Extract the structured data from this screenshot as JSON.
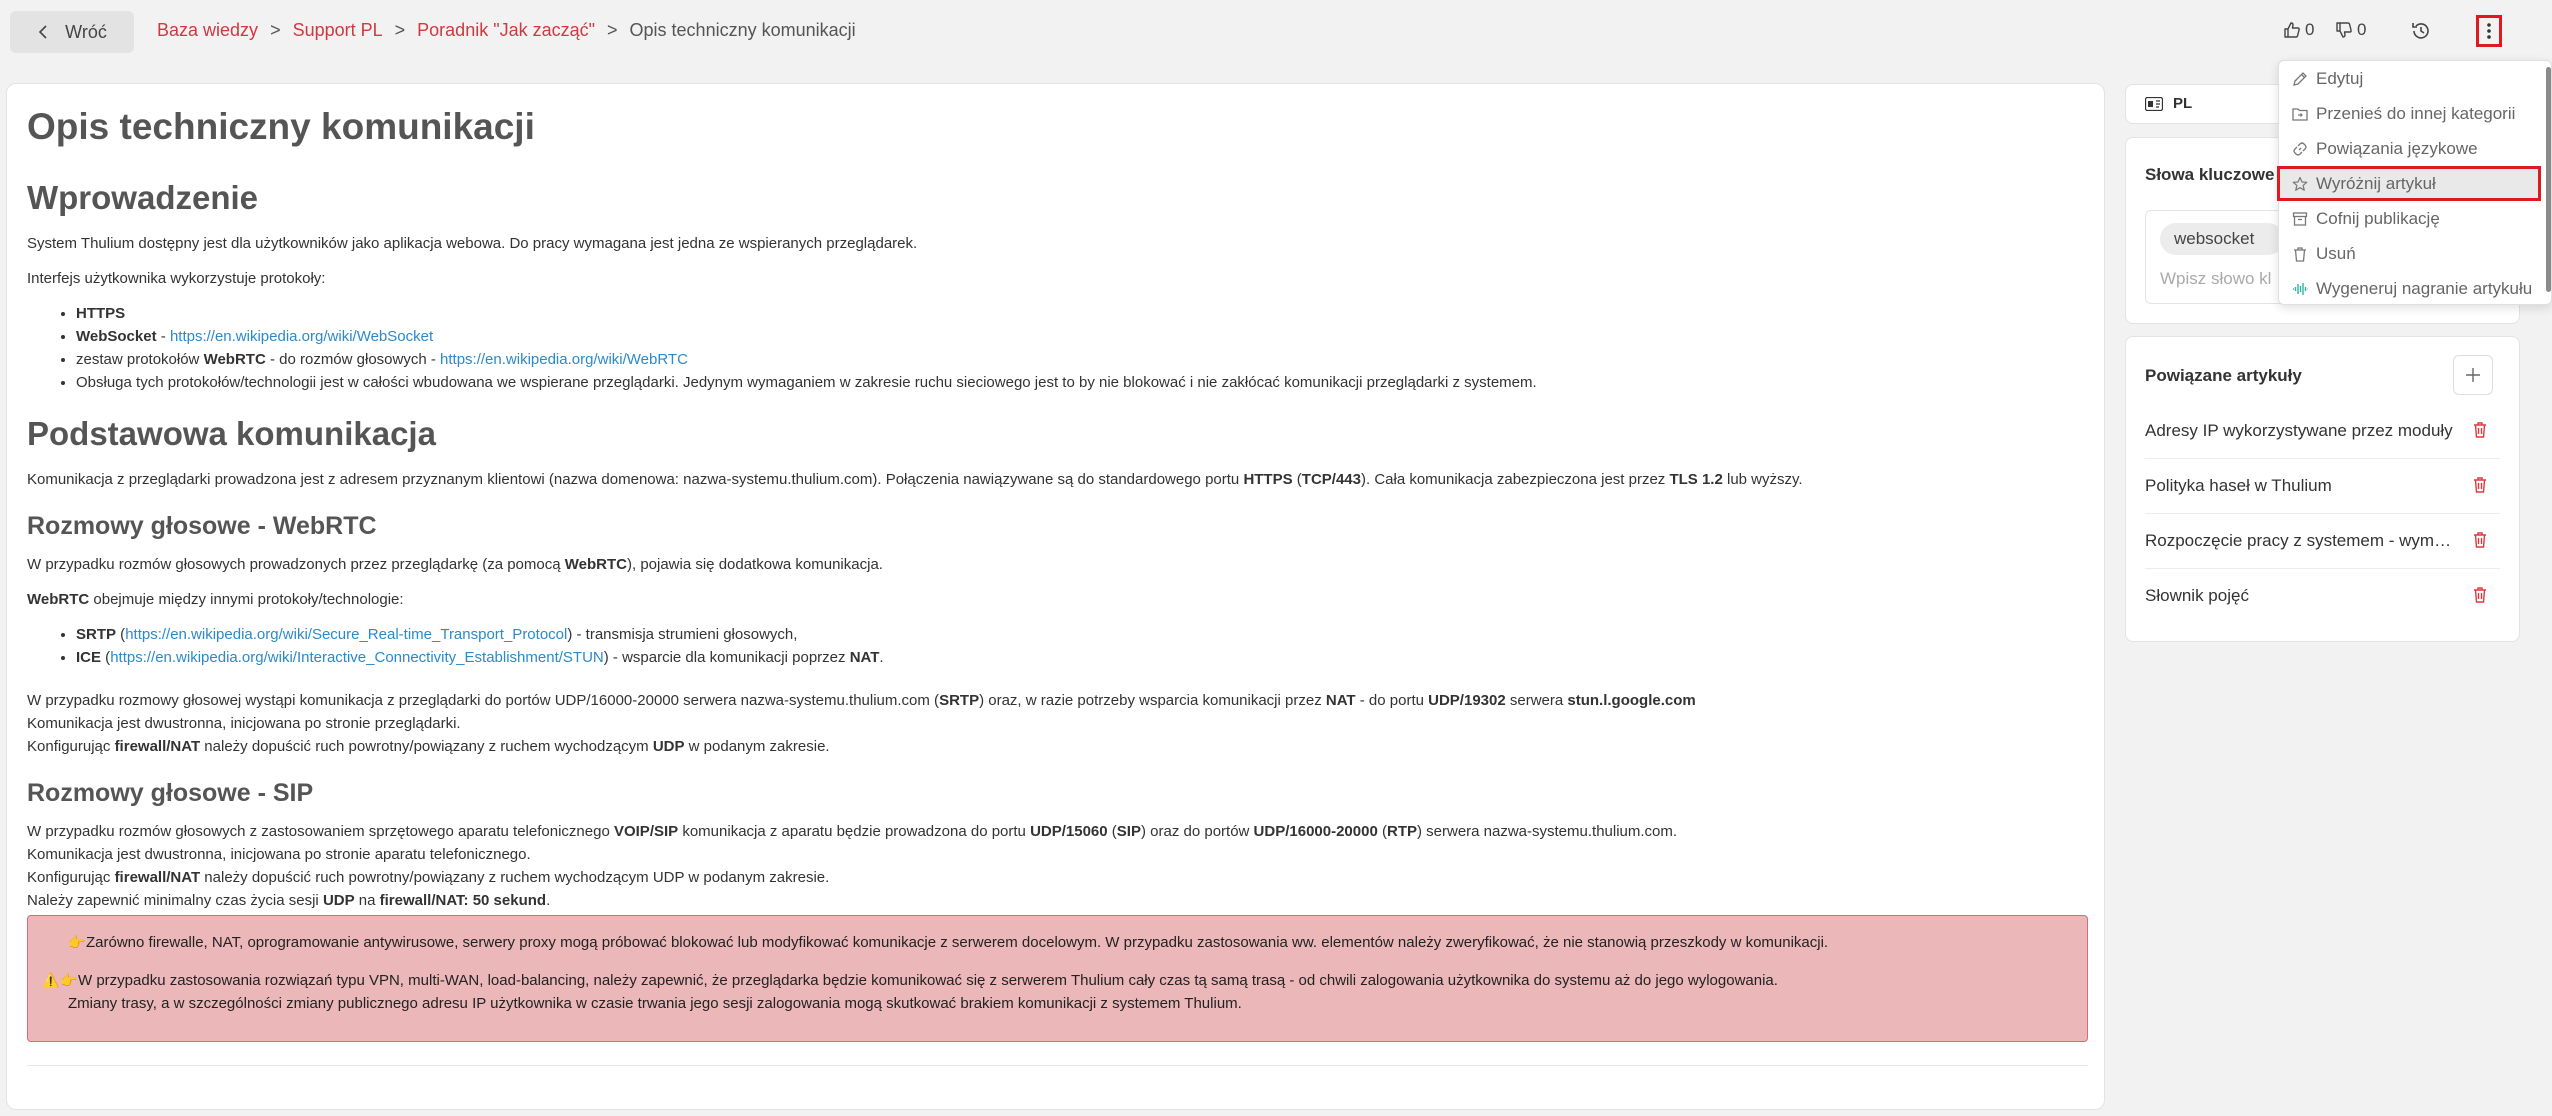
{
  "topbar": {
    "back_label": "Wróć",
    "breadcrumb": {
      "items": [
        "Baza wiedzy",
        "Support PL",
        "Poradnik \"Jak zacząć\""
      ],
      "separator": ">",
      "current": "Opis techniczny komunikacji"
    },
    "likes": "0",
    "dislikes": "0"
  },
  "article": {
    "title": "Opis techniczny komunikacji",
    "intro": {
      "heading": "Wprowadzenie",
      "p1": "System Thulium dostępny jest dla użytkowników jako aplikacja webowa. Do pracy wymagana jest jedna ze wspieranych przeglądarek.",
      "p2": "Interfejs użytkownika wykorzystuje protokoły:",
      "li1": "HTTPS",
      "li2_bold": "WebSocket",
      "li2_sep": " - ",
      "li2_link": "https://en.wikipedia.org/wiki/WebSocket",
      "li3_pre": "zestaw protokołów ",
      "li3_bold": "WebRTC",
      "li3_mid": " - do rozmów głosowych - ",
      "li3_link": "https://en.wikipedia.org/wiki/WebRTC",
      "li4": "Obsługa tych protokołów/technologii jest w całości wbudowana we wspierane przeglądarki. Jedynym wymaganiem w zakresie ruchu sieciowego jest to by nie blokować i nie zakłócać komunikacji przeglądarki z systemem."
    },
    "basic": {
      "heading": "Podstawowa komunikacja",
      "p_a": "Komunikacja z przeglądarki prowadzona jest z adresem przyznanym klientowi (nazwa domenowa: nazwa-systemu.thulium.com). Połączenia nawiązywane są do standardowego portu ",
      "p_b": "HTTPS",
      "p_c": " (",
      "p_d": "TCP/443",
      "p_e": "). Cała komunikacja zabezpieczona jest przez ",
      "p_f": "TLS 1.2",
      "p_g": " lub wyższy."
    },
    "webrtc": {
      "heading": "Rozmowy głosowe - WebRTC",
      "p1_a": "W przypadku rozmów głosowych prowadzonych przez przeglądarkę (za pomocą ",
      "p1_b": "WebRTC",
      "p1_c": "), pojawia się dodatkowa komunikacja.",
      "p2_a": "WebRTC",
      "p2_b": " obejmuje między innymi protokoły/technologie:",
      "li1_bold": "SRTP",
      "li1_open": " (",
      "li1_link": "https://en.wikipedia.org/wiki/Secure_Real-time_Transport_Protocol",
      "li1_rest": ") - transmisja strumieni głosowych,",
      "li2_bold": "ICE",
      "li2_open": " (",
      "li2_link": "https://en.wikipedia.org/wiki/Interactive_Connectivity_Establishment/STUN",
      "li2_rest": ") - wsparcie dla komunikacji poprzez ",
      "li2_nat": "NAT",
      "li2_dot": ".",
      "p3_a": "W przypadku rozmowy głosowej wystąpi komunikacja z przeglądarki do portów UDP/16000-20000 serwera nazwa-systemu.thulium.com (",
      "p3_b": "SRTP",
      "p3_c": ") oraz, w razie potrzeby wsparcia komunikacji przez ",
      "p3_d": "NAT",
      "p3_e": " - do portu ",
      "p3_f": "UDP/19302",
      "p3_g": " serwera ",
      "p3_h": "stun.l.google.com",
      "p4": "Komunikacja jest dwustronna, inicjowana po stronie przeglądarki.",
      "p5_a": "Konfigurując ",
      "p5_b": "firewall/NAT",
      "p5_c": " należy dopuścić ruch powrotny/powiązany z ruchem wychodzącym ",
      "p5_d": "UDP",
      "p5_e": " w podanym zakresie."
    },
    "sip": {
      "heading": "Rozmowy głosowe - SIP",
      "p1_a": "W przypadku rozmów głosowych z zastosowaniem sprzętowego aparatu telefonicznego ",
      "p1_b": "VOIP/SIP",
      "p1_c": " komunikacja z aparatu będzie prowadzona do portu ",
      "p1_d": "UDP/15060",
      "p1_e": " (",
      "p1_f": "SIP",
      "p1_g": ") oraz do portów ",
      "p1_h": "UDP/16000-20000",
      "p1_i": " (",
      "p1_j": "RTP",
      "p1_k": ") serwera nazwa-systemu.thulium.com.",
      "p2": "Komunikacja jest dwustronna, inicjowana po stronie aparatu telefonicznego.",
      "p3_a": "Konfigurując ",
      "p3_b": "firewall/NAT",
      "p3_c": " należy dopuścić ruch powrotny/powiązany z ruchem wychodzącym UDP w podanym zakresie.",
      "p4_a": "Należy zapewnić minimalny czas życia sesji ",
      "p4_b": "UDP",
      "p4_c": " na ",
      "p4_d": "firewall/NAT: 50 sekund",
      "p4_e": "."
    },
    "alert": {
      "line1": "Zarówno firewalle, NAT, oprogramowanie antywirusowe, serwery proxy mogą próbować blokować lub modyfikować komunikacje z serwerem docelowym. W przypadku zastosowania ww. elementów należy zweryfikować, że nie stanowią przeszkody w komunikacji.",
      "line2": "W przypadku zastosowania rozwiązań typu VPN, multi-WAN, load-balancing, należy zapewnić, że przeglądarka będzie komunikować się z serwerem Thulium cały czas tą samą trasą - od chwili zalogowania użytkownika do systemu aż do jego wylogowania.",
      "line3": "Zmiany trasy, a w szczególności zmiany publicznego adresu IP użytkownika w czasie trwania jego sesji zalogowania mogą skutkować brakiem komunikacji z systemem Thulium.",
      "hand_emoji": "👉",
      "warning_emoji": "⚠️"
    }
  },
  "sidebar": {
    "language": "PL",
    "keywords": {
      "title": "Słowa kluczowe",
      "chips": [
        "websocket"
      ],
      "placeholder": "Wpisz słowo kl"
    },
    "related": {
      "title": "Powiązane artykuły",
      "items": [
        "Adresy IP wykorzystywane przez moduły",
        "Polityka haseł w Thulium",
        "Rozpoczęcie pracy z systemem - wymagania",
        "Słownik pojęć"
      ]
    }
  },
  "menu": {
    "items": [
      {
        "label": "Edytuj",
        "icon": "edit-icon"
      },
      {
        "label": "Przenieś do innej kategorii",
        "icon": "move-folder-icon"
      },
      {
        "label": "Powiązania językowe",
        "icon": "link-icon"
      },
      {
        "label": "Wyróżnij artykuł",
        "icon": "star-icon"
      },
      {
        "label": "Cofnij publikację",
        "icon": "archive-icon"
      },
      {
        "label": "Usuń",
        "icon": "trash-icon"
      },
      {
        "label": "Wygeneruj nagranie artykułu",
        "icon": "audio-wave-icon"
      }
    ]
  },
  "colors": {
    "link": "#2a8acb",
    "breadcrumb_link": "#d2383e",
    "highlight_border": "#e0191f",
    "alert_bg": "#ebb7b9",
    "alert_border": "#d96c72",
    "delete_icon": "#e0393f"
  }
}
